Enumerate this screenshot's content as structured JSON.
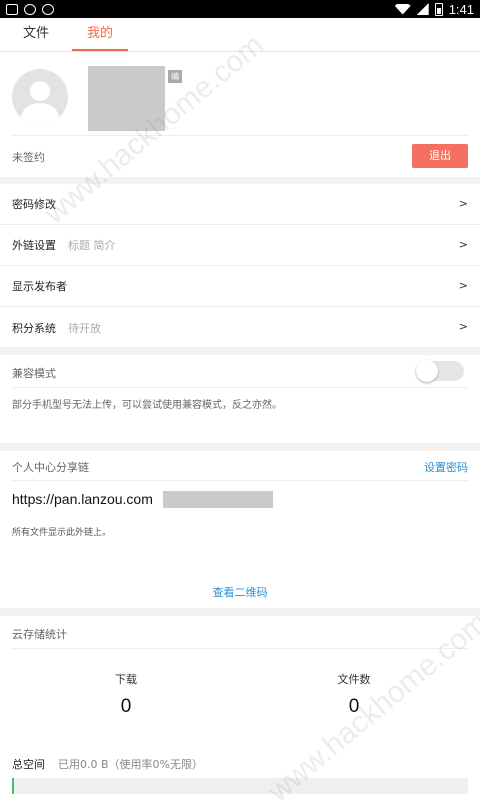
{
  "status_bar": {
    "time": "1:41"
  },
  "tabs": [
    {
      "label": "文件"
    },
    {
      "label": "我的"
    }
  ],
  "profile": {
    "edit_badge": "编",
    "sign_status": "未签约",
    "logout_label": "退出"
  },
  "settings": [
    {
      "label": "密码修改",
      "sub": "",
      "chev": ">"
    },
    {
      "label": "外链设置",
      "sub": "标题 简介",
      "chev": ">"
    },
    {
      "label": "显示发布者",
      "sub": "",
      "chev": ">"
    },
    {
      "label": "积分系统",
      "sub": "待开放",
      "chev": ">"
    }
  ],
  "compat": {
    "title": "兼容模式",
    "toggle_on": false,
    "desc": "部分手机型号无法上传，可以尝试使用兼容模式，反之亦然。"
  },
  "share": {
    "title": "个人中心分享链",
    "set_password": "设置密码",
    "url": "https://pan.lanzou.com",
    "note": "所有文件显示此外链上。",
    "qr_link": "查看二维码"
  },
  "stats": {
    "title": "云存储统计",
    "download_caption": "下载",
    "download_value": "0",
    "files_caption": "文件数",
    "files_value": "0",
    "total_label": "总空间",
    "total_value": "已用0.0 B（使用率0%无限）",
    "usage_fraction": 0,
    "bar_color": "#3cc26c"
  },
  "watermark": "www.hackhome.com",
  "colors": {
    "accent": "#f26a4e",
    "link": "#2b8fd6",
    "logout": "#f57060"
  }
}
